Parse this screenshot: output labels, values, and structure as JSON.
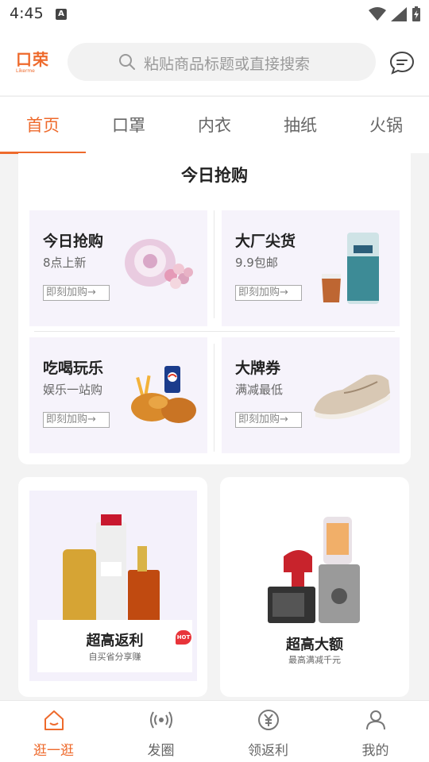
{
  "status_bar": {
    "time": "4:45",
    "notification_icon": "A"
  },
  "header": {
    "logo_text": "口荣",
    "logo_sub": "Likerme",
    "search_placeholder": "粘贴商品标题或直接搜索",
    "icons": [
      "search-icon",
      "message-icon"
    ]
  },
  "tabs": [
    {
      "label": "首页",
      "active": true
    },
    {
      "label": "口罩",
      "active": false
    },
    {
      "label": "内衣",
      "active": false
    },
    {
      "label": "抽纸",
      "active": false
    },
    {
      "label": "火锅",
      "active": false
    }
  ],
  "deals": {
    "title": "今日抢购",
    "tiles": [
      {
        "title": "今日抢购",
        "subtitle": "8点上新",
        "button": "即刻加购→"
      },
      {
        "title": "大厂尖货",
        "subtitle": "9.9包邮",
        "button": "即刻加购→"
      },
      {
        "title": "吃喝玩乐",
        "subtitle": "娱乐一站购",
        "button": "即刻加购→"
      },
      {
        "title": "大牌券",
        "subtitle": "满减最低",
        "button": "即刻加购→"
      }
    ]
  },
  "promo_cards": [
    {
      "title": "超高返利",
      "subtitle": "自买省分享赚",
      "badge": "HOT"
    },
    {
      "title": "超高大额",
      "subtitle": "最高满减千元"
    }
  ],
  "bottom_nav": [
    {
      "label": "逛一逛",
      "icon": "home-icon",
      "active": true
    },
    {
      "label": "发圈",
      "icon": "broadcast-icon",
      "active": false
    },
    {
      "label": "领返利",
      "icon": "yuan-coin-icon",
      "active": false
    },
    {
      "label": "我的",
      "icon": "user-icon",
      "active": false
    }
  ],
  "colors": {
    "accent": "#ee6a2c",
    "tile_bg": "#f6f3fb"
  }
}
